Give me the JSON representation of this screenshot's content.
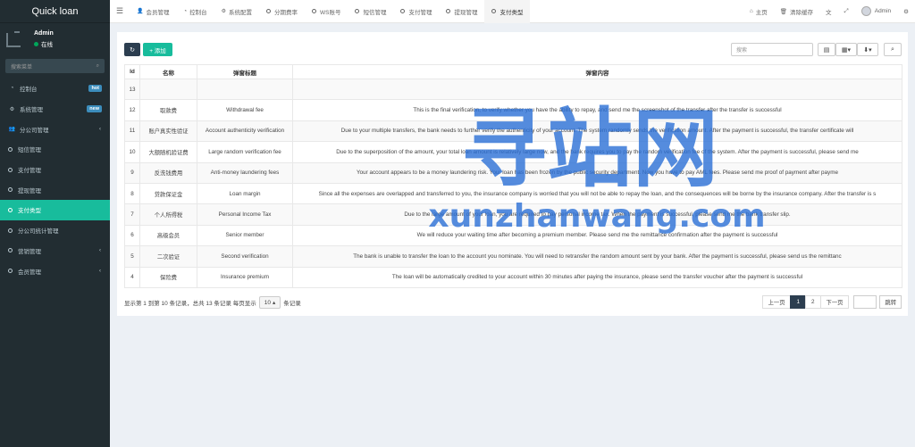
{
  "brand": {
    "title": "Quick loan"
  },
  "user": {
    "name": "Admin",
    "status": "在线"
  },
  "sidebar": {
    "search_placeholder": "搜索菜单",
    "items": [
      {
        "label": "控制台",
        "icon": "dashboard-icon",
        "badge": "hot",
        "badge_color": "#3c8dbc"
      },
      {
        "label": "系统管理",
        "icon": "cogs-icon",
        "badge": "new",
        "badge_color": "#3c8dbc"
      },
      {
        "label": "分公司管理",
        "icon": "users-icon",
        "caret": "‹"
      },
      {
        "label": "短信管理",
        "icon": "circle-icon"
      },
      {
        "label": "支付管理",
        "icon": "circle-icon"
      },
      {
        "label": "提现管理",
        "icon": "circle-icon"
      },
      {
        "label": "支付类型",
        "icon": "circle-icon",
        "active": true
      },
      {
        "label": "分公司统计管理",
        "icon": "circle-icon"
      },
      {
        "label": "营销管理",
        "icon": "circle-icon",
        "caret": "‹"
      },
      {
        "label": "会员管理",
        "icon": "circle-icon",
        "caret": "‹"
      }
    ]
  },
  "topbar": {
    "tabs": [
      {
        "label": "会员管理",
        "icon": "user-icon"
      },
      {
        "label": "控制台",
        "icon": "dashboard-icon"
      },
      {
        "label": "系统配置",
        "icon": "gear-icon"
      },
      {
        "label": "分期费率",
        "icon": "circle-icon"
      },
      {
        "label": "WS账号",
        "icon": "circle-icon"
      },
      {
        "label": "短信管理",
        "icon": "circle-icon"
      },
      {
        "label": "支付管理",
        "icon": "circle-icon"
      },
      {
        "label": "提现管理",
        "icon": "circle-icon"
      },
      {
        "label": "支付类型",
        "icon": "circle-icon",
        "active": true
      }
    ],
    "home_label": "主页",
    "clear_cache_label": "清除缓存",
    "admin_label": "Admin"
  },
  "toolbar": {
    "add_label": "+ 添加",
    "search_placeholder": "搜索"
  },
  "table": {
    "headers": [
      "Id",
      "名称",
      "弹窗标题",
      "弹窗内容"
    ],
    "rows": [
      {
        "id": "13",
        "name": "",
        "title": "",
        "content": ""
      },
      {
        "id": "12",
        "name": "取款费",
        "title": "Withdrawal fee",
        "content": "This is the final verification, to verify whether you have the ability to repay, and send me the screenshot of the transfer after the transfer is successful"
      },
      {
        "id": "11",
        "name": "账户真实性验证",
        "title": "Account authenticity verification",
        "content": "Due to your multiple transfers, the bank needs to further verify the authenticity of your account. The system randomly sends the verification amount. After the payment is successful, the transfer certificate will"
      },
      {
        "id": "10",
        "name": "大额随机验证费",
        "title": "Large random verification fee",
        "content": "Due to the superposition of the amount, your total loan amount is relatively large now, and the bank requires you to pay the random verification fee of the system. After the payment is successful, please send me"
      },
      {
        "id": "9",
        "name": "反洗钱费用",
        "title": "Anti-money laundering fees",
        "content": "Your account appears to be a money laundering risk. Your loan has been frozen by the public security department. Now you have to pay AML fees. Please send me proof of payment after payme"
      },
      {
        "id": "8",
        "name": "贷款保证金",
        "title": "Loan margin",
        "content": "Since all the expenses are overlapped and transferred to you, the insurance company is worried that you will not be able to repay the loan, and the consequences will be borne by the insurance company. After the transfer is s"
      },
      {
        "id": "7",
        "name": "个人所得税",
        "title": "Personal Income Tax",
        "content": "Due to the large amount of your loan, you are required to pay personal income tax. When the payment is successful, please send me the bank transfer slip."
      },
      {
        "id": "6",
        "name": "高级会员",
        "title": "Senior member",
        "content": "We will reduce your waiting time after becoming a premium member. Please send me the remittance confirmation after the payment is successful"
      },
      {
        "id": "5",
        "name": "二次验证",
        "title": "Second verification",
        "content": "The bank is unable to transfer the loan to the account you nominate. You will need to retransfer the random amount sent by your bank. After the payment is successful, please send us the remittanc"
      },
      {
        "id": "4",
        "name": "保险费",
        "title": "Insurance premium",
        "content": "The loan will be automatically credited to your account within 30 minutes after paying the insurance, please send the transfer voucher after the payment is successful"
      }
    ]
  },
  "footer": {
    "summary_prefix": "显示第 1 到第 10 条记录，总共 13 条记录 每页显示",
    "page_size": "10",
    "summary_suffix": "条记录",
    "prev_label": "上一页",
    "pages": [
      "1",
      "2"
    ],
    "current_page": "1",
    "next_label": "下一页",
    "jump_label": "跳转"
  },
  "watermark": {
    "chinese": "寻站网",
    "domain": "xunzhanwang.com",
    "color": "#2b6fd6"
  }
}
